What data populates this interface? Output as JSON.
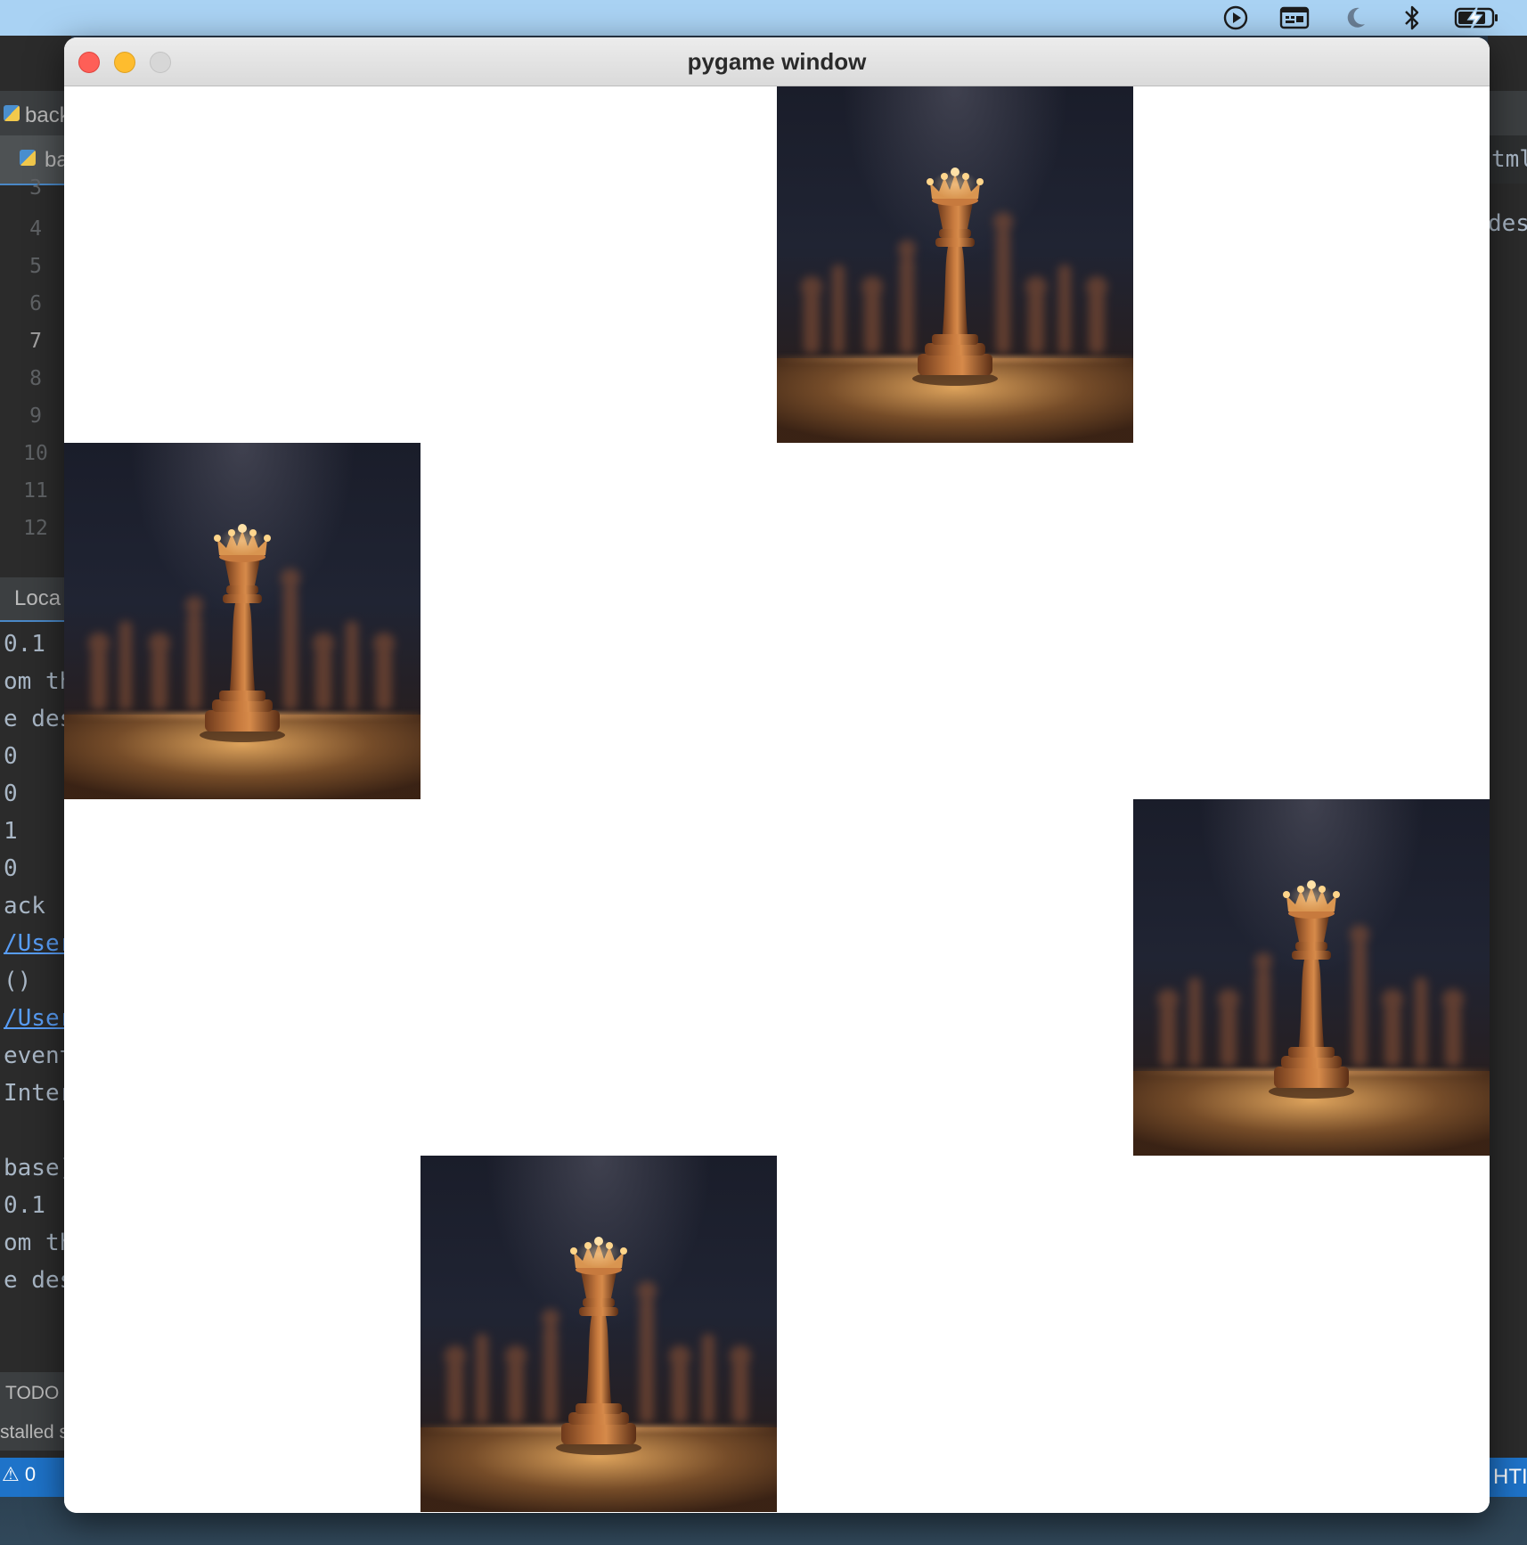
{
  "menubar": {
    "icons": [
      "play-circle-icon",
      "keyboard-viewer-icon",
      "moon-icon",
      "bluetooth-icon",
      "battery-charging-icon"
    ]
  },
  "ide_left": {
    "tab1_label": "back",
    "tab2_label": "ba",
    "line_numbers": [
      "3",
      "4",
      "5",
      "6",
      "7",
      "8",
      "9",
      "10",
      "11",
      "12"
    ],
    "panel_tab": "Loca",
    "console_lines": [
      {
        "text": " 0.1",
        "link": false
      },
      {
        "text": "om th",
        "link": false
      },
      {
        "text": "e des",
        "link": false
      },
      {
        "text": " 0",
        "link": false
      },
      {
        "text": " 0",
        "link": false
      },
      {
        "text": " 1",
        "link": false
      },
      {
        "text": " 0",
        "link": false
      },
      {
        "text": "ack (",
        "link": false
      },
      {
        "text": "/User",
        "link": true
      },
      {
        "text": "()",
        "link": false
      },
      {
        "text": "/User",
        "link": true
      },
      {
        "text": "event",
        "link": false
      },
      {
        "text": "Inter",
        "link": false
      },
      {
        "text": "",
        "link": false
      },
      {
        "text": "base)",
        "link": false
      },
      {
        "text": " 0.1",
        "link": false
      },
      {
        "text": "om th",
        "link": false
      },
      {
        "text": "e des",
        "link": false
      }
    ],
    "todo_label": "TODO",
    "status_text": "stalled s",
    "blue_bar_text": "⚠ 0"
  },
  "ide_right": {
    "tab_text": "tml",
    "line_text": "desc",
    "blue_text": "HTI"
  },
  "window": {
    "title": "pygame window",
    "sprite_count": 4
  },
  "colors": {
    "menubar": "#a9d2f3",
    "close": "#fe5f57",
    "minimize": "#febc2e",
    "zoom": "#d7d7d7",
    "ide_bg": "#2b2b2b",
    "accent": "#1e73c9"
  }
}
